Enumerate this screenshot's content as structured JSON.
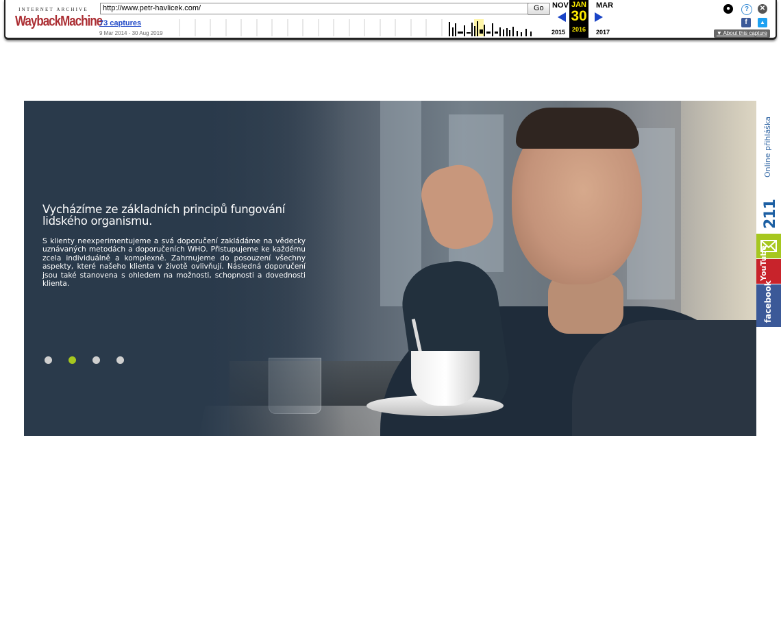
{
  "wayback": {
    "logo_top": "INTERNET ARCHIVE",
    "logo_main": "WaybackMachine",
    "url": "http://www.petr-havlicek.com/",
    "go_label": "Go",
    "captures_link": "73 captures",
    "date_range": "9 Mar 2014 - 30 Aug 2019",
    "prev_month": "NOV",
    "current_month": "JAN",
    "next_month": "MAR",
    "current_day": "30",
    "prev_year": "2015",
    "current_year": "2016",
    "next_year": "2017",
    "about_label": "About this capture",
    "colors": {
      "logo": "#ab2e33",
      "link": "#1a44c6",
      "highlight": "#ffed00"
    }
  },
  "hero": {
    "heading": "Vycházíme ze základních principů fungování lidského organismu.",
    "body": "S klienty neexperimentujeme a svá doporučení zakládáme na vědecky uznávaných metodách a doporučeních WHO. Přistupujeme ke každému zcela individuálně a komplexně. Zahrnujeme do posouzení všechny aspekty, které našeho klienta v životě ovlivňují. Následná doporučení jsou také stanovena s ohledem na možnosti, schopnosti a dovednosti klienta.",
    "slides": 4,
    "active_slide": 2,
    "colors": {
      "active_dot": "#a6c71f",
      "dot": "#cfcfcf"
    }
  },
  "sidebar": {
    "online_label": "Online přihláška",
    "brand_number": "211",
    "youtube_label": "YouTube",
    "facebook_label": "facebook",
    "colors": {
      "mail": "#a6c71f",
      "youtube": "#c8232b",
      "facebook": "#3b5998"
    }
  }
}
